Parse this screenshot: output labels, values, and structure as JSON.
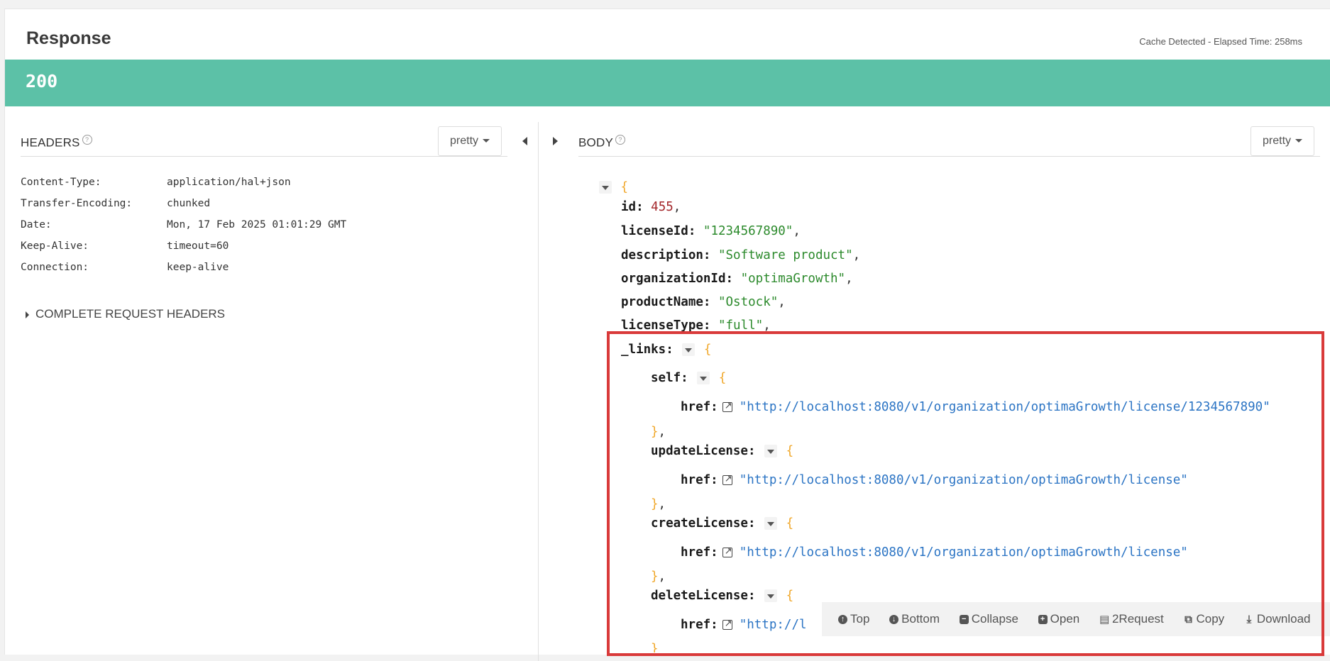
{
  "response": {
    "title": "Response",
    "elapsed": "Cache Detected - Elapsed Time: 258ms",
    "status_code": "200"
  },
  "headers": {
    "title": "HEADERS",
    "format": "pretty",
    "rows": [
      {
        "key": "Content-Type:",
        "value": "application/hal+json"
      },
      {
        "key": "Transfer-Encoding:",
        "value": "chunked"
      },
      {
        "key": "Date:",
        "value": "Mon, 17 Feb 2025 01:01:29 GMT"
      },
      {
        "key": "Keep-Alive:",
        "value": "timeout=60"
      },
      {
        "key": "Connection:",
        "value": "keep-alive"
      }
    ],
    "complete_request_label": "COMPLETE REQUEST HEADERS"
  },
  "body": {
    "title": "BODY",
    "format": "pretty",
    "json": {
      "open_brace": "{",
      "id_key": "id:",
      "id_val": "455",
      "licenseId_key": "licenseId:",
      "licenseId_val": "\"1234567890\"",
      "description_key": "description:",
      "description_val": "\"Software product\"",
      "organizationId_key": "organizationId:",
      "organizationId_val": "\"optimaGrowth\"",
      "productName_key": "productName:",
      "productName_val": "\"Ostock\"",
      "licenseType_key": "licenseType:",
      "licenseType_val": "\"full\"",
      "links_key": "_links:",
      "self_key": "self:",
      "self_href_key": "href:",
      "self_href": "\"http://localhost:8080/v1/organization/optimaGrowth/license/1234567890\"",
      "update_key": "updateLicense:",
      "update_href_key": "href:",
      "update_href": "\"http://localhost:8080/v1/organization/optimaGrowth/license\"",
      "create_key": "createLicense:",
      "create_href_key": "href:",
      "create_href": "\"http://localhost:8080/v1/organization/optimaGrowth/license\"",
      "delete_key": "deleteLicense:",
      "delete_href_key": "href:",
      "delete_href_partial": "\"http://l",
      "close_brace_comma": "},",
      "close_brace": "}"
    }
  },
  "toolbar": {
    "top": "Top",
    "bottom": "Bottom",
    "collapse": "Collapse",
    "open": "Open",
    "to_request": "2Request",
    "copy": "Copy",
    "download": "Download"
  },
  "colors": {
    "status_bar": "#5cc1a7",
    "highlight_border": "#d93a3a",
    "json_number": "#a3262a",
    "json_string": "#2c8a2c",
    "json_link": "#2b74c4",
    "json_brace": "#f0a72a"
  }
}
